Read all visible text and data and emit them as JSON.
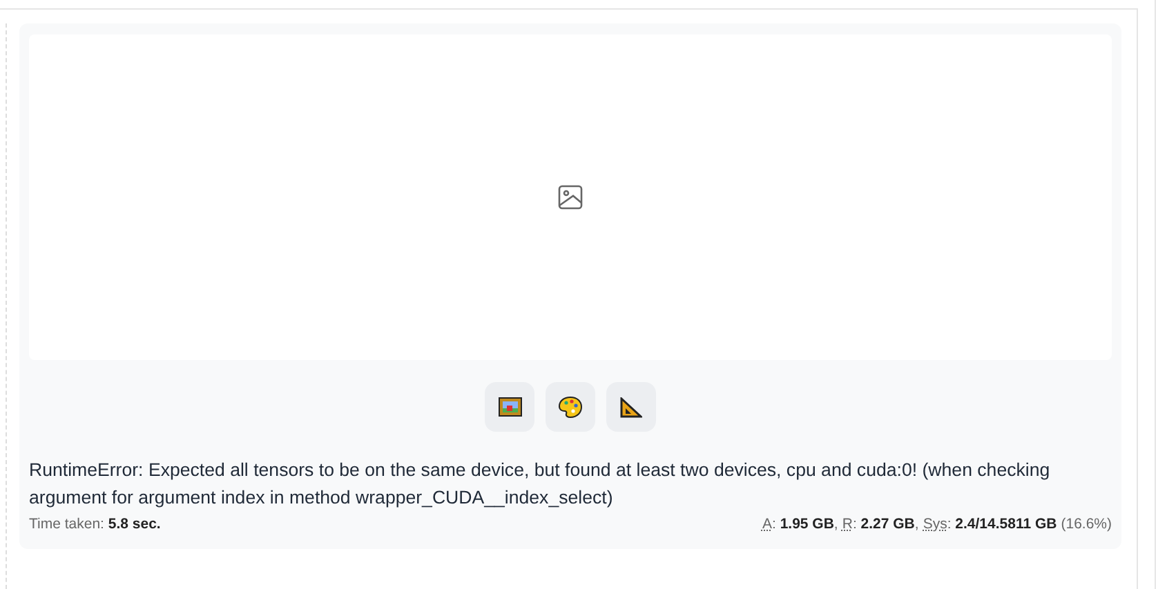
{
  "tool_buttons": [
    {
      "kind": "image"
    },
    {
      "kind": "palette"
    },
    {
      "kind": "triangle"
    }
  ],
  "error_message": "RuntimeError: Expected all tensors to be on the same device, but found at least two devices, cpu and cuda:0! (when checking argument for argument index in method wrapper_CUDA__index_select)",
  "time_taken": "Time taken: **5.8 sec.**",
  "memory": [
    {
      "abbr": "A",
      "rest": ": **1.95 GB**,"
    },
    {
      "abbr": "R",
      "rest": ": **2.27 GB**,"
    },
    {
      "abbr": "Sys",
      "rest": ": **2.4/14.5811 GB**"
    }
  ],
  "memory_percent": "(16.6%)"
}
